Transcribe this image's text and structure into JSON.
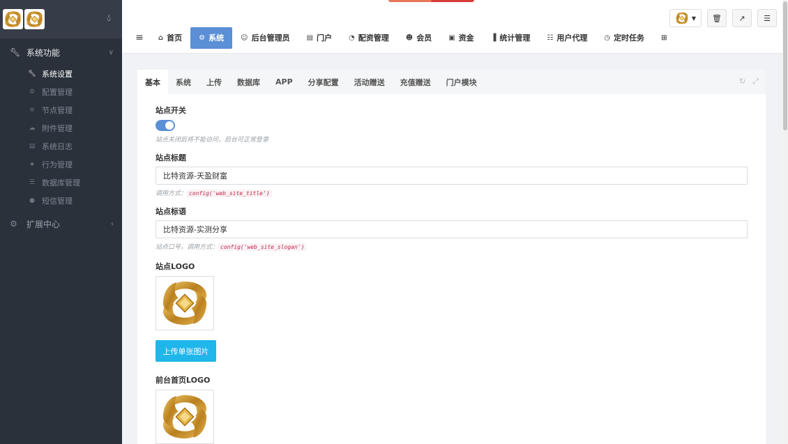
{
  "sidebar": {
    "group": {
      "label": "系统功能",
      "icon": "wrench-icon"
    },
    "items": [
      {
        "label": "系统设置",
        "icon": "wrench-icon",
        "active": true
      },
      {
        "label": "配置管理",
        "icon": "gears-icon"
      },
      {
        "label": "节点管理",
        "icon": "bars-icon"
      },
      {
        "label": "附件管理",
        "icon": "cloud-upload-icon"
      },
      {
        "label": "系统日志",
        "icon": "book-icon"
      },
      {
        "label": "行为管理",
        "icon": "star-icon"
      },
      {
        "label": "数据库管理",
        "icon": "database-icon"
      },
      {
        "label": "短信管理",
        "icon": "comment-icon"
      }
    ],
    "ext_group": {
      "label": "扩展中心",
      "icon": "gear-icon"
    }
  },
  "nav": {
    "items": [
      {
        "label": "首页",
        "icon": "home-icon"
      },
      {
        "label": "系统",
        "icon": "gear-icon",
        "active": true
      },
      {
        "label": "后台管理员",
        "icon": "user-icon"
      },
      {
        "label": "门户",
        "icon": "newspaper-icon"
      },
      {
        "label": "配资管理",
        "icon": "pie-chart-icon"
      },
      {
        "label": "会员",
        "icon": "users-icon"
      },
      {
        "label": "资金",
        "icon": "money-icon"
      },
      {
        "label": "统计管理",
        "icon": "bar-chart-icon"
      },
      {
        "label": "用户代理",
        "icon": "sitemap-icon"
      },
      {
        "label": "定时任务",
        "icon": "clock-icon"
      }
    ]
  },
  "tabs": [
    {
      "label": "基本",
      "active": true
    },
    {
      "label": "系统"
    },
    {
      "label": "上传"
    },
    {
      "label": "数据库"
    },
    {
      "label": "APP"
    },
    {
      "label": "分享配置"
    },
    {
      "label": "活动赠送"
    },
    {
      "label": "充值赠送"
    },
    {
      "label": "门户模块"
    }
  ],
  "form": {
    "site_switch": {
      "label": "站点开关",
      "on": true,
      "help": "站点关闭后将不能访问，后台可正常登录"
    },
    "site_title": {
      "label": "站点标题",
      "value": "比特资源-天盈财富",
      "help_prefix": "调用方式：",
      "code": "config('web_site_title')"
    },
    "site_slogan": {
      "label": "站点标语",
      "value": "比特资源-实测分享",
      "help_prefix": "站点口号，调用方式：",
      "code": "config('web_site_slogan')"
    },
    "site_logo": {
      "label": "站点LOGO"
    },
    "upload_label": "上传单张图片",
    "front_logo": {
      "label": "前台首页LOGO"
    }
  },
  "colors": {
    "sidebar_bg": "#2b313b",
    "accent": "#5b8fd6",
    "upload_btn": "#1fb6ea",
    "logo_gold": "#c9952f"
  }
}
